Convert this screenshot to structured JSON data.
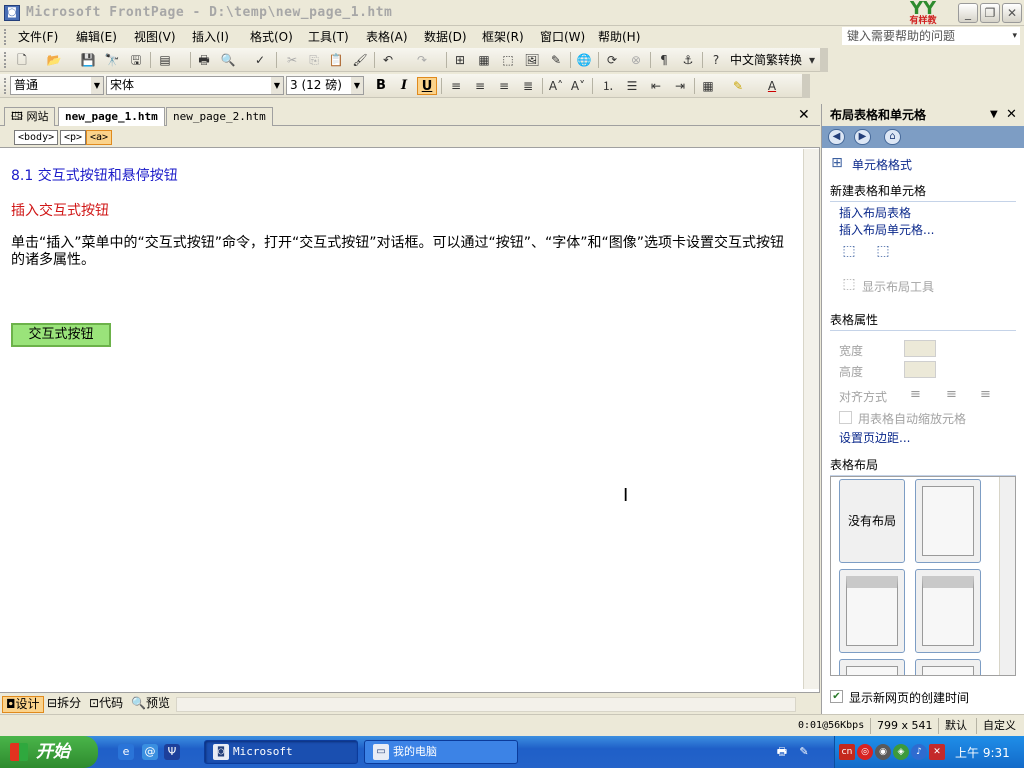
{
  "window": {
    "title": "Microsoft FrontPage - D:\\temp\\new_page_1.htm",
    "logo_top": "YY",
    "logo_bottom": "有样教"
  },
  "menu": {
    "items": [
      "文件(F)",
      "编辑(E)",
      "视图(V)",
      "插入(I)",
      "格式(O)",
      "工具(T)",
      "表格(A)",
      "数据(D)",
      "框架(R)",
      "窗口(W)",
      "帮助(H)"
    ],
    "help_placeholder": "键入需要帮助的问题"
  },
  "standard_toolbar": {
    "convert_label": "中文简繁转换"
  },
  "format_toolbar": {
    "style_value": "普通",
    "font_value": "宋体",
    "size_value": "3 (12 磅)"
  },
  "tabs": [
    {
      "label": "网站"
    },
    {
      "label": "new_page_1.htm"
    },
    {
      "label": "new_page_2.htm"
    }
  ],
  "tags": [
    "<body>",
    "<p>",
    "<a>"
  ],
  "document": {
    "heading1": "8.1 交互式按钮和悬停按钮",
    "heading2": "插入交互式按钮",
    "paragraph": "单击“插入”菜单中的“交互式按钮”命令，打开“交互式按钮”对话框。可以通过“按钮”、“字体”和“图像”选项卡设置交互式按钮的诸多属性。",
    "demo_button": "交互式按钮"
  },
  "view_tabs": [
    "设计",
    "拆分",
    "代码",
    "预览"
  ],
  "task_pane": {
    "title": "布局表格和单元格",
    "cell_format_link": "单元格格式",
    "new_section": "新建表格和单元格",
    "insert_layout_table": "插入布局表格",
    "insert_layout_cell": "插入布局单元格...",
    "show_layout_tool": "显示布局工具",
    "table_props_section": "表格属性",
    "width_label": "宽度",
    "height_label": "高度",
    "align_label": "对齐方式",
    "autoscale_label": "用表格自动缩放元格",
    "set_margins_link": "设置页边距...",
    "table_layout_section": "表格布局",
    "no_layout_label": "没有布局",
    "show_creation_time": "显示新网页的创建时间"
  },
  "statusbar": {
    "speed": "0:01@56Kbps",
    "resolution": "799 x 541",
    "mode": "默认",
    "custom": "自定义"
  },
  "taskbar": {
    "start_label": "开始",
    "task1": "Microsoft FrontP...",
    "task2": "我的电脑",
    "clock": "上午 9:31",
    "ime": "cn"
  }
}
